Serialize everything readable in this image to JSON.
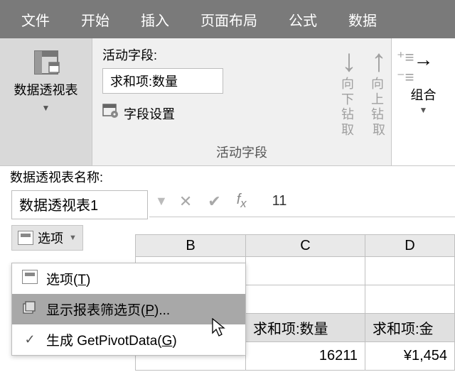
{
  "ribbon_tabs": [
    "文件",
    "开始",
    "插入",
    "页面布局",
    "公式",
    "数据"
  ],
  "pivot_table_group": {
    "button_label": "数据透视表"
  },
  "active_field": {
    "label": "活动字段:",
    "value": "求和项:数量",
    "settings_label": "字段设置",
    "group_caption": "活动字段"
  },
  "drill": {
    "down_label": "向下钻取",
    "up_label1": "向上钻",
    "up_label2": "取"
  },
  "combine": {
    "label": "组合"
  },
  "left_panel": {
    "name_label": "数据透视表名称:",
    "name_value": "数据透视表1",
    "options_label": "选项"
  },
  "dropdown": {
    "items": [
      {
        "icon": "options-icon",
        "label_pre": "选项(",
        "hotkey": "T",
        "label_post": ")"
      },
      {
        "icon": "pages-icon",
        "label_pre": "显示报表筛选页(",
        "hotkey": "P",
        "label_post": ")..."
      },
      {
        "icon": "check-icon",
        "label_pre": "生成 GetPivotData(",
        "hotkey": "G",
        "label_post": ")"
      }
    ]
  },
  "formula_bar": {
    "value": "11"
  },
  "grid": {
    "columns": [
      "B",
      "C",
      "D"
    ],
    "header_row": {
      "c": "求和项:数量",
      "d": "求和项:金"
    },
    "data_row": {
      "c": "16211",
      "d": "¥1,454"
    }
  }
}
